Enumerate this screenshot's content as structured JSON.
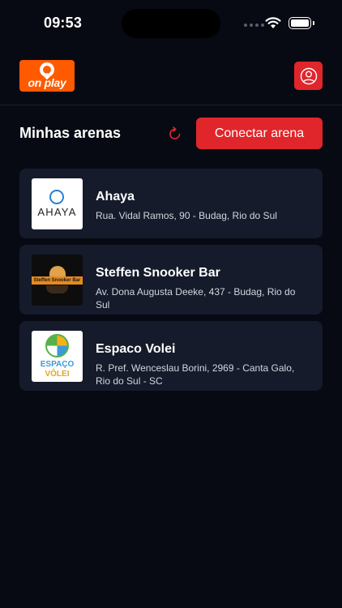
{
  "status_bar": {
    "time": "09:53"
  },
  "header": {
    "logo_text": "on play",
    "profile_icon": "user-circle-icon"
  },
  "section": {
    "title": "Minhas arenas",
    "refresh_icon": "refresh-icon",
    "connect_button": "Conectar arena"
  },
  "colors": {
    "background": "#070a12",
    "card": "#151b2b",
    "accent_red": "#e0262b",
    "brand_orange": "#ff5a00"
  },
  "arenas": [
    {
      "name": "Ahaya",
      "address": "Rua. Vidal Ramos, 90 - Budag, Rio do Sul",
      "logo_text": "AHAYA"
    },
    {
      "name": "Steffen Snooker Bar",
      "address": "Av. Dona Augusta Deeke, 437 - Budag, Rio do Sul",
      "logo_text": "Steffen Snooker Bar"
    },
    {
      "name": "Espaco Volei",
      "address": "R. Pref. Wenceslau Borini, 2969 - Canta Galo, Rio do Sul - SC",
      "logo_text_top": "ESPAÇO",
      "logo_text_bottom": "VÔLEI"
    }
  ]
}
